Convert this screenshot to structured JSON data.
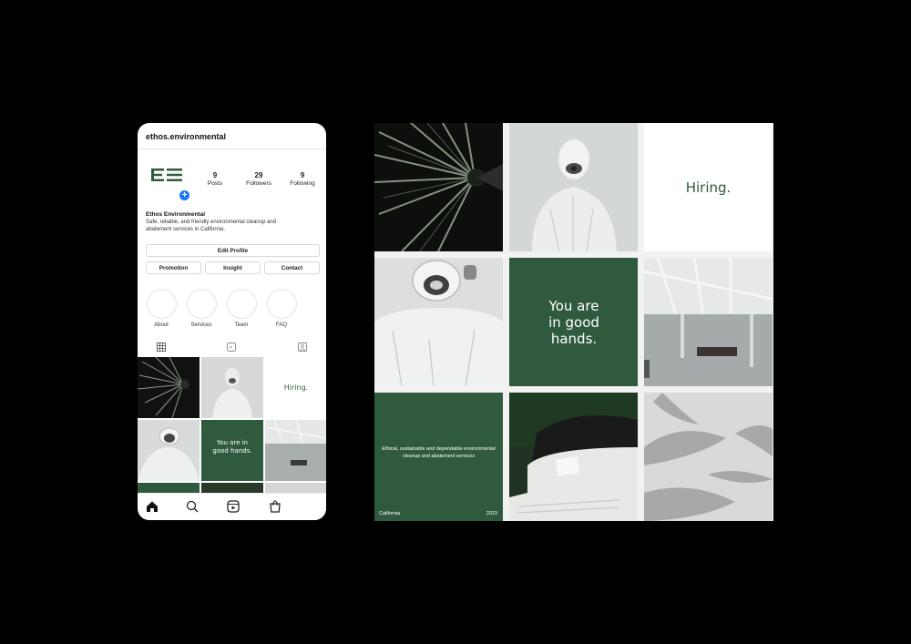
{
  "profile": {
    "username": "ethos.environmental",
    "stats": [
      {
        "value": "9",
        "label": "Posts"
      },
      {
        "value": "29",
        "label": "Followers"
      },
      {
        "value": "9",
        "label": "Following"
      }
    ],
    "name": "Ethos Environmental",
    "bio": "Safe, reliable, and friendly environmental cleanup and abatement services in California.",
    "edit_profile": "Edit Profile",
    "buttons": [
      "Promotion",
      "Insight",
      "Contact"
    ],
    "highlights": [
      "About",
      "Services",
      "Team",
      "FAQ"
    ],
    "add_badge": "+"
  },
  "posts": {
    "hiring": "Hiring.",
    "good_hands": "You are in good hands.",
    "tagline": "Ethical, sustainable and dependable environmental cleanup and abatement services",
    "location": "California",
    "year": "2023"
  },
  "colors": {
    "brand_green": "#2f5a3d",
    "badge_blue": "#1877f2"
  },
  "icons": [
    "grid-icon",
    "reels-icon",
    "tagged-icon",
    "home-icon",
    "search-icon",
    "reels-nav-icon",
    "shop-icon"
  ]
}
